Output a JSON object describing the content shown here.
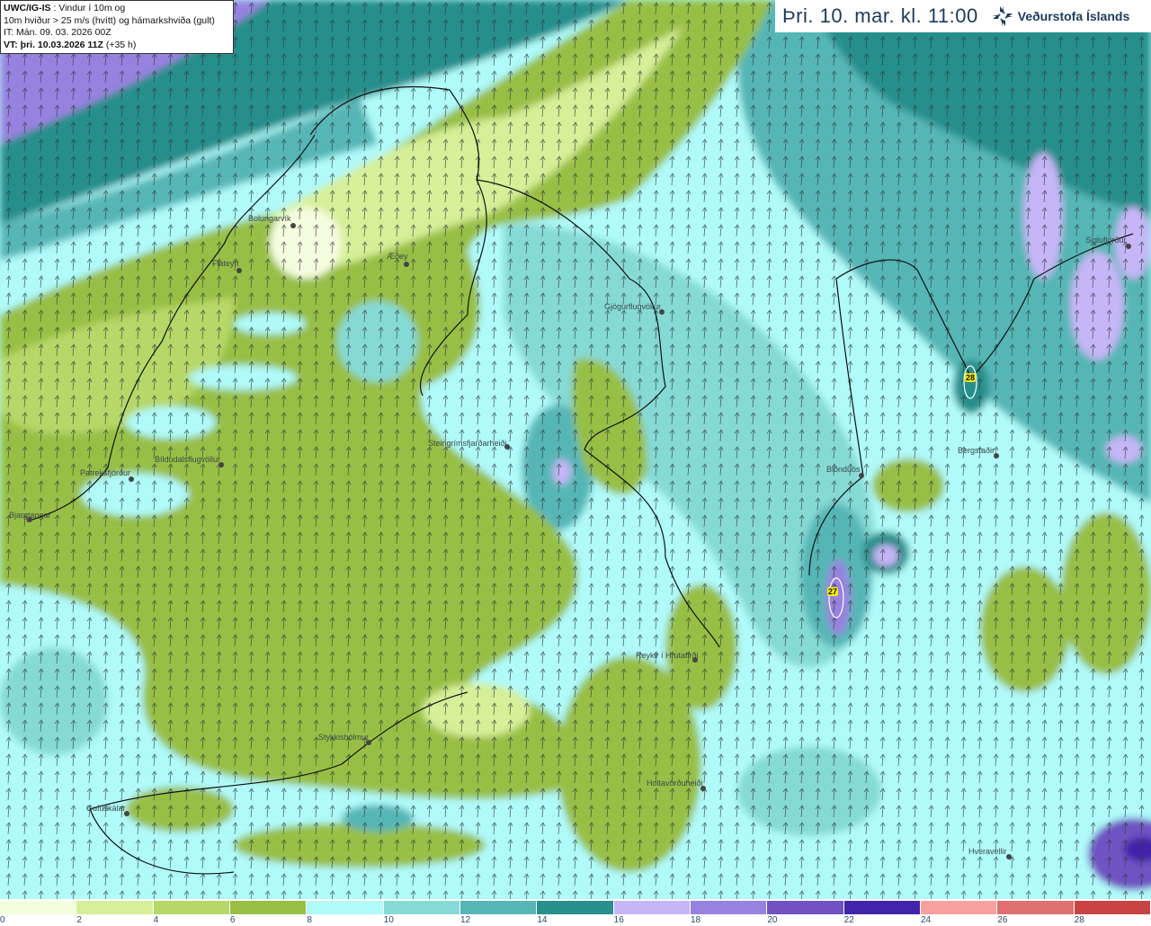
{
  "info": {
    "model": "UWC/IG-IS",
    "line1_rest": " : Vindur í 10m og",
    "line2": "10m hviður > 25 m/s (hvítt) og hámarkshviða (gult)",
    "line3": "IT: Mán. 09. 03. 2026 00Z",
    "vt_bold": "VT: þri. 10.03.2026 11Z",
    "vt_rest": " (+35 h)"
  },
  "header": {
    "valid_time": "Þri. 10. mar. kl. 11:00",
    "logo_text": "Veðurstofa Íslands"
  },
  "places": [
    {
      "name": "Bolungarvík"
    },
    {
      "name": "Flateyri"
    },
    {
      "name": "Æðey"
    },
    {
      "name": "Gjögurflugvöllur"
    },
    {
      "name": "Steingrímsfjarðarheiði"
    },
    {
      "name": "Bíldudalsflugvöllur"
    },
    {
      "name": "Patreksfjörður"
    },
    {
      "name": "Bjargtangar"
    },
    {
      "name": "Blönduós"
    },
    {
      "name": "Siglufjörður"
    },
    {
      "name": "Bergstaðir"
    },
    {
      "name": "Reykir í Hrútafirði"
    },
    {
      "name": "Stykkishólmur"
    },
    {
      "name": "Holtavörðuheiði"
    },
    {
      "name": "Gufuskálar"
    },
    {
      "name": "Hveravellir"
    }
  ],
  "max_gusts": [
    {
      "value": "28"
    },
    {
      "value": "27"
    }
  ],
  "legend": {
    "unit_hint": "m/s",
    "ticks": [
      "0",
      "2",
      "4",
      "6",
      "8",
      "10",
      "12",
      "14",
      "16",
      "18",
      "20",
      "22",
      "24",
      "26",
      "28"
    ],
    "colors": [
      "#f5fddf",
      "#d6ef98",
      "#b6d868",
      "#98bf44",
      "#b0fafa",
      "#86dad6",
      "#56b6b6",
      "#278f8c",
      "#c6b6f8",
      "#9882e0",
      "#7052c2",
      "#4224a8",
      "#f8a0a0",
      "#e07070",
      "#c84444"
    ]
  },
  "colors": {
    "brand": "#1d3a5c",
    "gust_contour": "#ffffff",
    "max_gust_badge": "#f8f000"
  }
}
